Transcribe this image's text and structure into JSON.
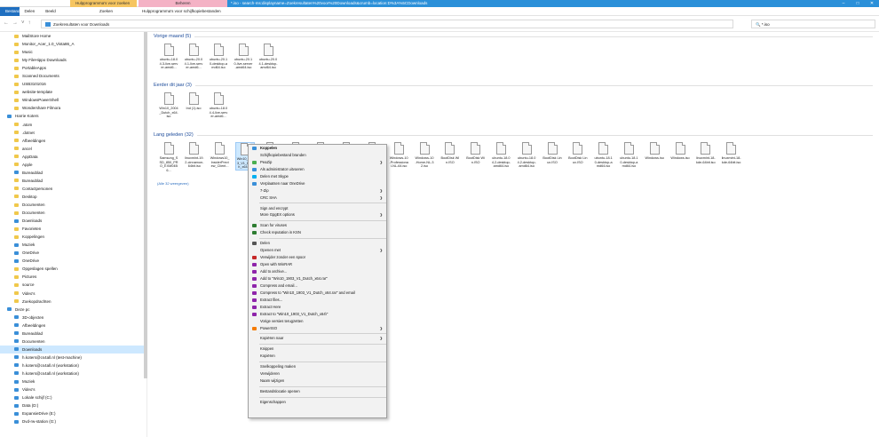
{
  "ribbon": {
    "ctx_search": "Hulpprogramma's voor zoeken",
    "ctx_manage": "Beheren",
    "title": "*.iso - search-ms:displayname=Zoekresultaten%20voor%20Downloads&crumb=location:D%3A%5CDownloads",
    "tabs": [
      "Bestand",
      "Start",
      "Delen",
      "Beeld"
    ],
    "tab_search": "Zoeken",
    "tab_disc": "Hulpprogramma's voor schijfkopiebestanden"
  },
  "address": {
    "text": "Zoekresultaten voor Downloads"
  },
  "search": {
    "value": "*.iso"
  },
  "sidebar": [
    {
      "label": "MailStore Home",
      "ico": "fold"
    },
    {
      "label": "Monitor_Acer_1.0_Vista86_A",
      "ico": "fold"
    },
    {
      "label": "Music",
      "ico": "fold"
    },
    {
      "label": "My FileHippo Downloads",
      "ico": "fold"
    },
    {
      "label": "PortableApps",
      "ico": "fold"
    },
    {
      "label": "Scanned Documents",
      "ico": "fold"
    },
    {
      "label": "USB3101016",
      "ico": "fold"
    },
    {
      "label": "website-template",
      "ico": "fold"
    },
    {
      "label": "WindowsPowerShell",
      "ico": "fold"
    },
    {
      "label": "Wondershare Filmora",
      "ico": "fold"
    },
    {
      "label": "Harrie Koters",
      "ico": "blue"
    },
    {
      "label": ".atom",
      "ico": "fold"
    },
    {
      "label": ".dotnet",
      "ico": "fold"
    },
    {
      "label": "Afbeeldingen",
      "ico": "fold"
    },
    {
      "label": "ancel",
      "ico": "fold"
    },
    {
      "label": "AppData",
      "ico": "fold"
    },
    {
      "label": "Apple",
      "ico": "fold"
    },
    {
      "label": "Bureaublad",
      "ico": "blue"
    },
    {
      "label": "Bureaublad",
      "ico": "fold"
    },
    {
      "label": "Contactpersonen",
      "ico": "fold"
    },
    {
      "label": "Desktop",
      "ico": "fold"
    },
    {
      "label": "Documenten",
      "ico": "fold"
    },
    {
      "label": "Documenten",
      "ico": "fold"
    },
    {
      "label": "Downloads",
      "ico": "blue"
    },
    {
      "label": "Favorieten",
      "ico": "fold"
    },
    {
      "label": "Koppelingen",
      "ico": "fold"
    },
    {
      "label": "Muziek",
      "ico": "blue"
    },
    {
      "label": "OneDrive",
      "ico": "blue"
    },
    {
      "label": "OneDrive",
      "ico": "blue"
    },
    {
      "label": "Opgeslagen spellen",
      "ico": "fold"
    },
    {
      "label": "Pictures",
      "ico": "fold"
    },
    {
      "label": "source",
      "ico": "fold"
    },
    {
      "label": "Video's",
      "ico": "fold"
    },
    {
      "label": "Zoekopdrachten",
      "ico": "fold"
    },
    {
      "label": "Deze pc",
      "ico": "blue"
    },
    {
      "label": "3D-objecten",
      "ico": "blue"
    },
    {
      "label": "Afbeeldingen",
      "ico": "blue"
    },
    {
      "label": "Bureaublad",
      "ico": "blue"
    },
    {
      "label": "Documenten",
      "ico": "blue"
    },
    {
      "label": "Downloads",
      "ico": "blue",
      "selected": true
    },
    {
      "label": "h.koters@cs4all.nl (test-machine)",
      "ico": "blue"
    },
    {
      "label": "h.koters@cs4all.nl (workstation)",
      "ico": "blue"
    },
    {
      "label": "h.koters@cs4all.nl (workstation)",
      "ico": "blue"
    },
    {
      "label": "Muziek",
      "ico": "blue"
    },
    {
      "label": "Video's",
      "ico": "blue"
    },
    {
      "label": "Lokale schijf (C:)",
      "ico": "blue"
    },
    {
      "label": "Data (D:)",
      "ico": "blue"
    },
    {
      "label": "ExpansieDrive (E:)",
      "ico": "blue"
    },
    {
      "label": "Dvd-rw-station (G:)",
      "ico": "blue"
    }
  ],
  "groups": [
    {
      "label": "Vorige maand (5)"
    },
    {
      "label": "Eerder dit jaar (3)"
    },
    {
      "label": "Lang geleden (32)"
    }
  ],
  "files_month": [
    "ubuntu-18.04.3-live-server-amd6...",
    "ubuntu-20.04.1-live-server-amd6...",
    "ubuntu-20.10-desktop-amd64.iso",
    "ubuntu-20.10-live-server-amd64.iso",
    "ubuntu-20.04.1-desktop-amd64.iso"
  ],
  "files_year": [
    "Win10_2004_Dutch_x64.iso",
    "Ind (1).iso",
    "ubuntu-18.04.4-live-server-amd6..."
  ],
  "files_long": [
    "Samsung_SSD_850_PRO_EXM04B6...",
    "linuxmint-19.2-cinnamon-64bit.iso",
    "Windows10_InsiderPreview_Client...",
    "Win10_1903_V1_Dutch_x64.iso",
    "Windows-10-Home-NL-32.iso",
    "Windows-10-Professional-NL-64.iso",
    "Windows-10-Home-NL-64.iso",
    "Windows-10-Professional-NL-32.iso",
    "Windows-10-Home-NL-64.iso",
    "Windows-10-Professional-NL-64.iso",
    "Windows-10-Home-NL-32.iso",
    "BootDisk Win.ISO",
    "BootDisk Win.ISO",
    "ubuntu-18.04.2-desktop-amd64.iso",
    "ubuntu-18.04.2-desktop-amd64.iso",
    "BootDisk Linux.ISO",
    "BootDisk Linux.ISO",
    "ubuntu-18.10-desktop-amd64.iso",
    "ubuntu-18.10-desktop-amd64.iso",
    "Windows.iso",
    "Windows.iso",
    "linuxmint-18-kde-64bit.iso",
    "linuxmint-18-kde-64bit.iso"
  ],
  "show_all": "(Alle 32 weergeven)",
  "context_menu": [
    {
      "label": "Koppelen",
      "bold": true,
      "ic": "#3a8fd8"
    },
    {
      "label": "Schijfkopiebestand branden"
    },
    {
      "label": "PeaZip",
      "ic": "#4caf50",
      "sub": true
    },
    {
      "label": "Als administrator uitvoeren",
      "ic": "#3a8fd8"
    },
    {
      "label": "Delen met Skype",
      "ic": "#00aff0"
    },
    {
      "label": "Verplaatsen naar OneDrive",
      "ic": "#3a8fd8"
    },
    {
      "label": "7-Zip",
      "sub": true
    },
    {
      "label": "CRC SHA",
      "sub": true
    },
    {
      "sep": true
    },
    {
      "label": "Sign and encrypt"
    },
    {
      "label": "More GpgEX options",
      "sub": true
    },
    {
      "sep": true
    },
    {
      "label": "Scan for viruses",
      "ic": "#2e7d32"
    },
    {
      "label": "Check reputation in KSN",
      "ic": "#2e7d32"
    },
    {
      "sep": true
    },
    {
      "label": "Delen",
      "ic": "#555"
    },
    {
      "label": "Openen met",
      "sub": true
    },
    {
      "label": "Verwijder zonder een spoor",
      "ic": "#c62828"
    },
    {
      "label": "Open with WinRAR",
      "ic": "#8e24aa"
    },
    {
      "label": "Add to archive...",
      "ic": "#8e24aa"
    },
    {
      "label": "Add to \"Win10_1903_V1_Dutch_x64.rar\"",
      "ic": "#8e24aa"
    },
    {
      "label": "Compress and email...",
      "ic": "#8e24aa"
    },
    {
      "label": "Compress to \"Win10_1903_V1_Dutch_x64.rar\" and email",
      "ic": "#8e24aa"
    },
    {
      "label": "Extract files...",
      "ic": "#8e24aa"
    },
    {
      "label": "Extract Here",
      "ic": "#8e24aa"
    },
    {
      "label": "Extract to \"Win10_1903_V1_Dutch_x64\\\"",
      "ic": "#8e24aa"
    },
    {
      "label": "Vorige versies terugzetten"
    },
    {
      "label": "PowerISO",
      "ic": "#f57c00",
      "sub": true
    },
    {
      "sep": true
    },
    {
      "label": "Kopiëren naar",
      "sub": true
    },
    {
      "sep": true
    },
    {
      "label": "Knippen"
    },
    {
      "label": "Kopiëren"
    },
    {
      "sep": true
    },
    {
      "label": "Snelkoppeling maken"
    },
    {
      "label": "Verwijderen"
    },
    {
      "label": "Naam wijzigen"
    },
    {
      "sep": true
    },
    {
      "label": "Bestandslocatie openen"
    },
    {
      "sep": true
    },
    {
      "label": "Eigenschappen"
    }
  ]
}
